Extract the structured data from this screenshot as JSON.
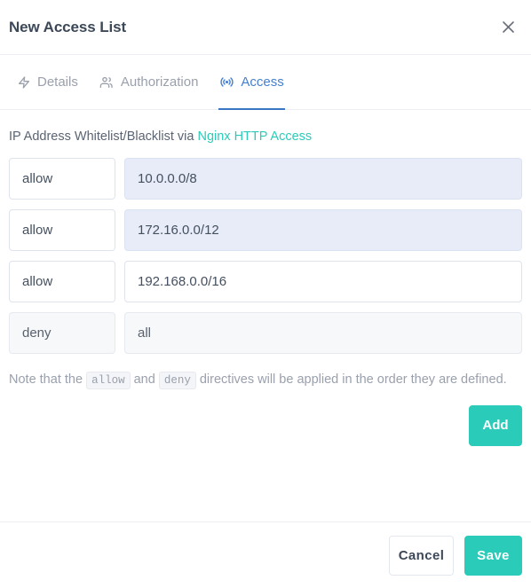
{
  "header": {
    "title": "New Access List",
    "close_icon": "close-icon"
  },
  "tabs": [
    {
      "label": "Details",
      "icon": "lightning-bolt-icon",
      "active": false
    },
    {
      "label": "Authorization",
      "icon": "users-icon",
      "active": false
    },
    {
      "label": "Access",
      "icon": "broadcast-icon",
      "active": true
    }
  ],
  "main": {
    "lead_prefix": "IP Address Whitelist/Blacklist via ",
    "lead_link": "Nginx HTTP Access",
    "rows": [
      {
        "directive": "allow",
        "address": "10.0.0.0/8",
        "state": "state-highlight"
      },
      {
        "directive": "allow",
        "address": "172.16.0.0/12",
        "state": "state-highlight"
      },
      {
        "directive": "allow",
        "address": "192.168.0.0/16",
        "state": "state-plain"
      },
      {
        "directive": "deny",
        "address": "all",
        "state": "state-muted"
      }
    ],
    "note": {
      "part1": "Note that the ",
      "code1": "allow",
      "part2": " and ",
      "code2": "deny",
      "part3": " directives will be applied in the order they are defined."
    },
    "add_label": "Add"
  },
  "footer": {
    "cancel_label": "Cancel",
    "save_label": "Save"
  },
  "colors": {
    "accent_teal": "#2bcbba",
    "active_tab_blue": "#467fcf",
    "tab_underline_blue": "#3b76c4",
    "title_text": "#3c4858",
    "muted_text": "#9aa0ac",
    "row_highlight_bg": "#e7ecf8",
    "row_muted_bg": "#f7f8fa",
    "field_border": "#dfe3ec"
  }
}
